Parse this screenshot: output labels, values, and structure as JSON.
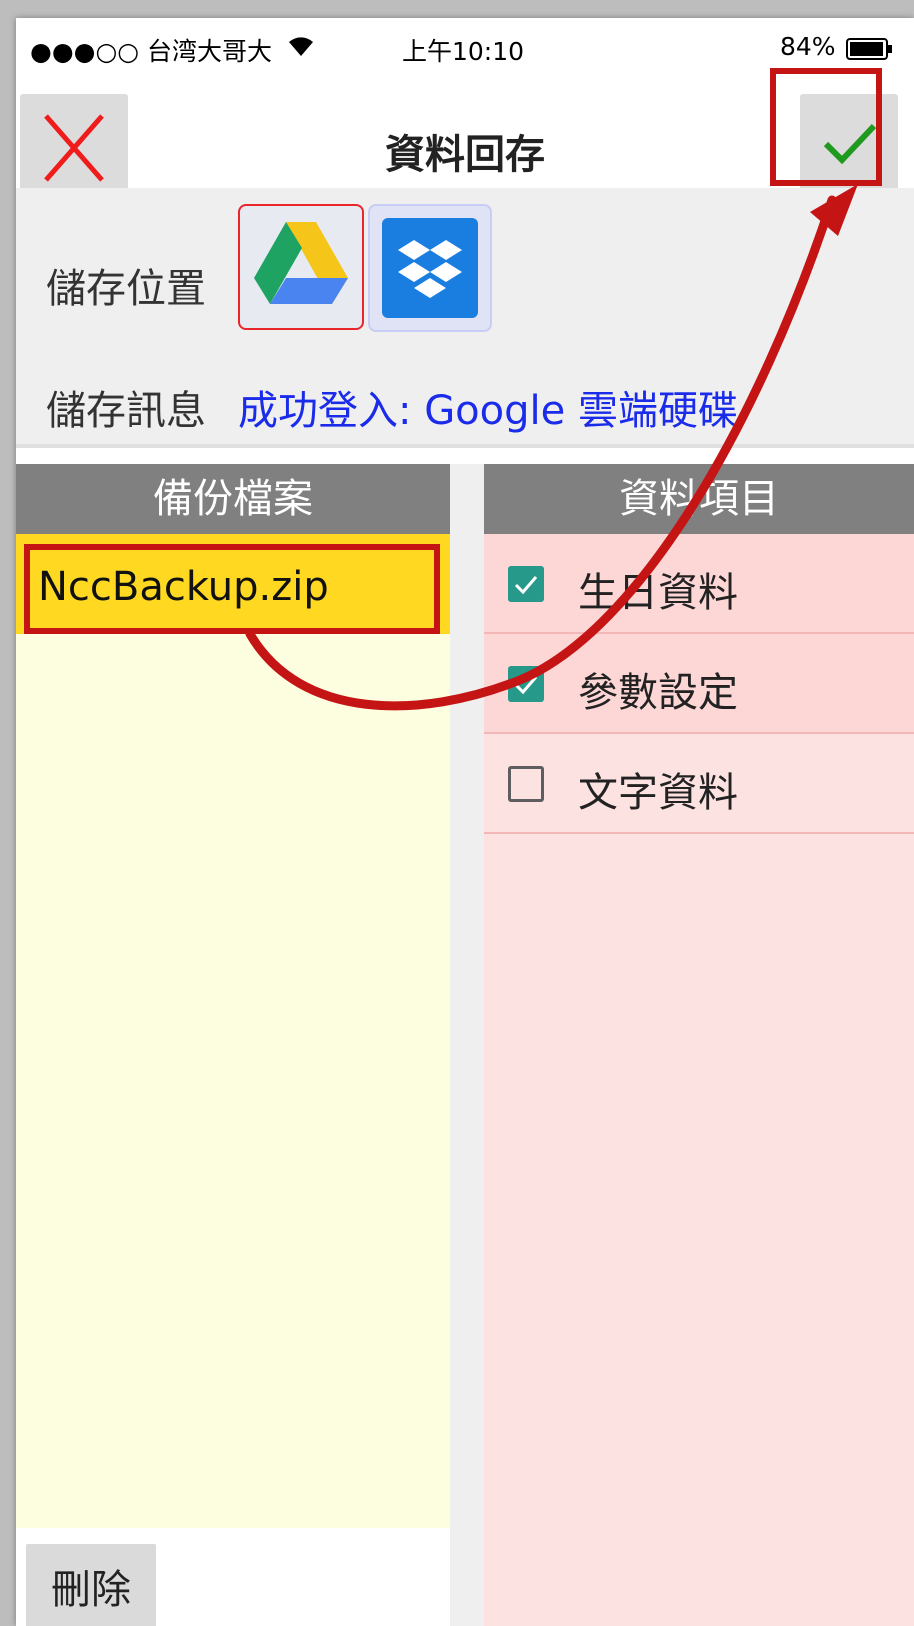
{
  "status_bar": {
    "carrier": "●●●○○ 台湾大哥大",
    "time": "上午10:10",
    "battery": "84%"
  },
  "nav": {
    "title": "資料回存",
    "close_icon": "close-x-icon",
    "confirm_icon": "checkmark-icon"
  },
  "settings": {
    "location_label": "儲存位置",
    "message_label": "儲存訊息",
    "message_value": "成功登入: Google 雲端硬碟",
    "services": [
      "google-drive-icon",
      "dropbox-icon"
    ]
  },
  "backup": {
    "header": "備份檔案",
    "files": [
      "NccBackup.zip"
    ],
    "delete_label": "刪除"
  },
  "items": {
    "header": "資料項目",
    "rows": [
      {
        "label": "生日資料",
        "checked": true
      },
      {
        "label": "參數設定",
        "checked": true
      },
      {
        "label": "文字資料",
        "checked": false
      }
    ]
  },
  "colors": {
    "accent": "#26998a",
    "highlight": "#c41414",
    "link": "#1a2bea",
    "selected_file": "#ffd921"
  }
}
